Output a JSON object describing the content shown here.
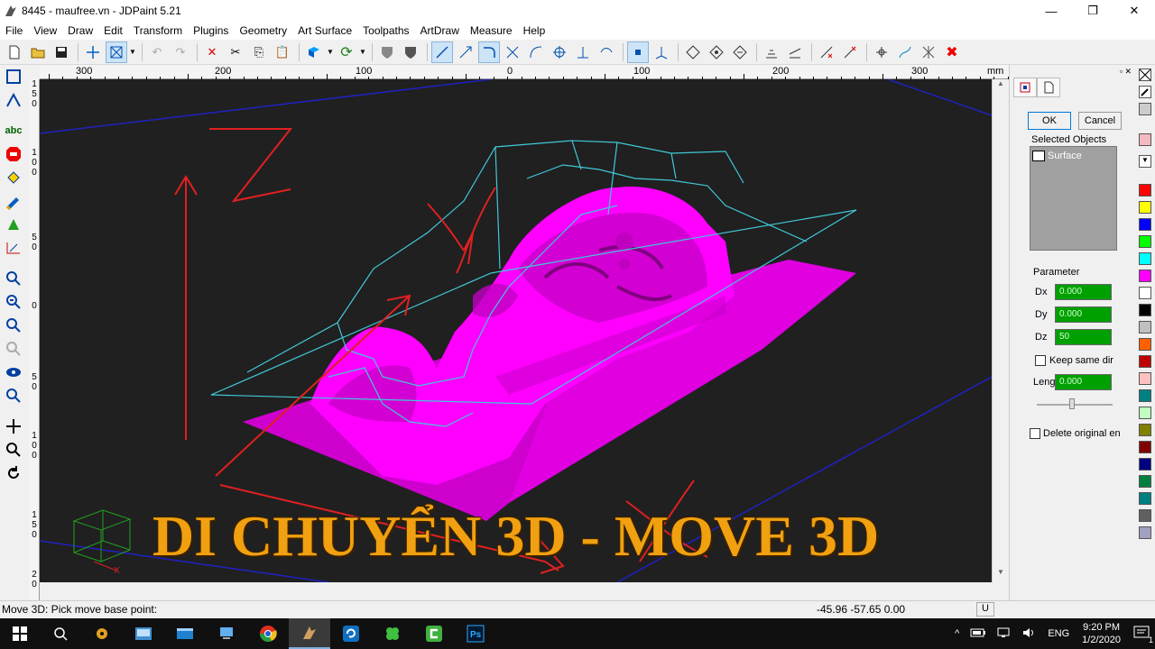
{
  "window": {
    "title": "8445 - maufree.vn - JDPaint 5.21",
    "controls": [
      "—",
      "❐",
      "✕"
    ]
  },
  "menu": [
    "File",
    "View",
    "Draw",
    "Edit",
    "Transform",
    "Plugins",
    "Geometry",
    "Art Surface",
    "Toolpaths",
    "ArtDraw",
    "Measure",
    "Help"
  ],
  "ruler": {
    "h_labels": [
      "300",
      "200",
      "100",
      "0",
      "100",
      "200",
      "300"
    ],
    "unit": "mm",
    "v_labels": [
      [
        "1",
        "5",
        "0"
      ],
      [
        "1",
        "0",
        "0"
      ],
      [
        "5",
        "0"
      ],
      [
        "0"
      ],
      [
        "5",
        "0"
      ],
      [
        "1",
        "0",
        "0"
      ],
      [
        "1",
        "5",
        "0"
      ],
      [
        "2",
        "0"
      ]
    ]
  },
  "viewport": {
    "overlay_text": "DI CHUYỂN 3D - MOVE 3D",
    "colors": {
      "background": "#202020",
      "model": "#ff00ff",
      "wireframe": "#40c8d8",
      "annotation": "#e02020",
      "grid": "#2020c0"
    }
  },
  "properties": {
    "ok_label": "OK",
    "cancel_label": "Cancel",
    "selected_objects_label": "Selected Objects",
    "selected_items": [
      "Surface"
    ],
    "parameter_label": "Parameter",
    "params": [
      {
        "name": "Dx",
        "value": "0.000"
      },
      {
        "name": "Dy",
        "value": "0.000"
      },
      {
        "name": "Dz",
        "value": "50"
      }
    ],
    "keep_same_dir_label": "Keep same dir",
    "length_label": "Length",
    "length_value": "0.000",
    "delete_original_label": "Delete original en"
  },
  "palette": [
    "#f4b8c0",
    "#ff0000",
    "#ffff00",
    "#0000ff",
    "#00ff00",
    "#00ffff",
    "#ff00ff",
    "#ffffff",
    "#000000",
    "#c0c0c0",
    "#ff6000",
    "#c00000",
    "#ffc0c0",
    "#008080",
    "#c0ffc0",
    "#808000",
    "#800000",
    "#000080",
    "#008040",
    "#008080",
    "#606060",
    "#a0a0c0"
  ],
  "status": {
    "message": "Move 3D: Pick move base point:",
    "coords": "-45.96 -57.65 0.00",
    "unit_btn": "U"
  },
  "taskbar": {
    "time": "9:20 PM",
    "date": "1/2/2020",
    "lang": "ENG",
    "notification_count": "1"
  }
}
